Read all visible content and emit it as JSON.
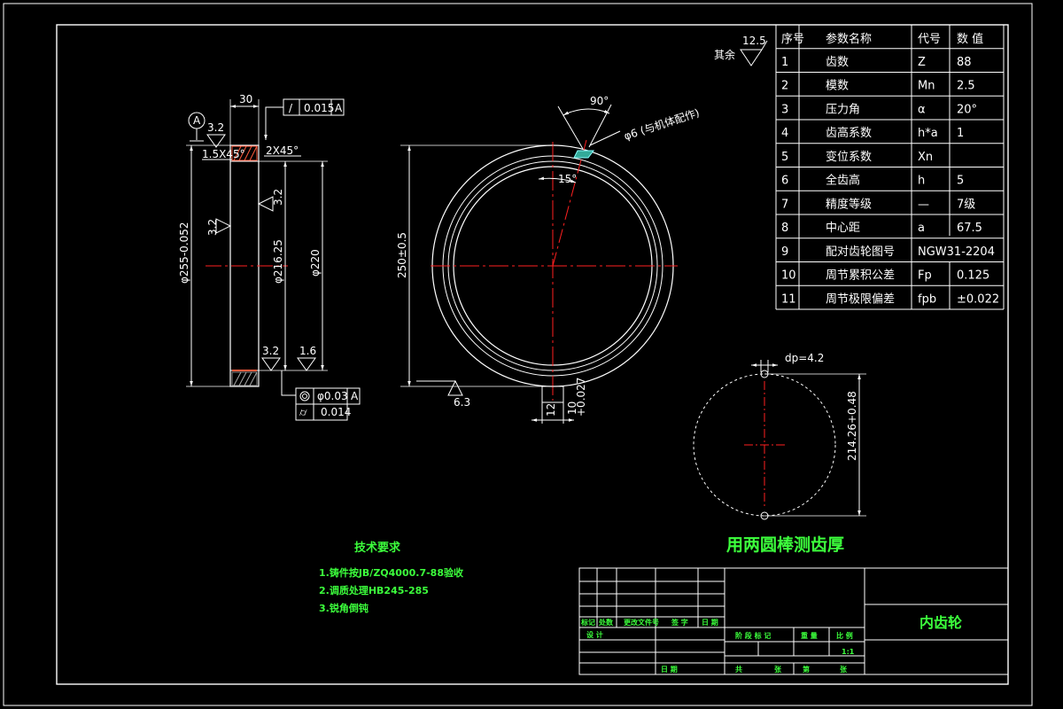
{
  "rough_other": {
    "label": "其余",
    "value": "12.5"
  },
  "param_table": {
    "headers": [
      "序号",
      "参数名称",
      "代号",
      "数 值"
    ],
    "rows": [
      [
        "1",
        "齿数",
        "Z",
        "88"
      ],
      [
        "2",
        "模数",
        "Mn",
        "2.5"
      ],
      [
        "3",
        "压力角",
        "α",
        "20°"
      ],
      [
        "4",
        "齿高系数",
        "h*a",
        "1"
      ],
      [
        "5",
        "变位系数",
        "Xn",
        ""
      ],
      [
        "6",
        "全齿高",
        "h",
        "5"
      ],
      [
        "7",
        "精度等级",
        "—",
        "7级"
      ],
      [
        "8",
        "中心距",
        "a",
        "67.5"
      ],
      [
        "9",
        "配对齿轮图号",
        "NGW31-2204",
        ""
      ],
      [
        "10",
        "周节累积公差",
        "Fp",
        "0.125"
      ],
      [
        "11",
        "周节极限偏差",
        "fpb",
        "±0.022"
      ]
    ]
  },
  "section_view": {
    "dim_width": "30",
    "tol_flatness": {
      "symbol": "/",
      "value": "0.015",
      "datum": "A"
    },
    "datum_label": "A",
    "chamfer_left": "1.5X45°",
    "chamfer_right": "2X45°",
    "rough_top": "3.2",
    "rough_mid": "3.2",
    "rough_left": "3.2",
    "rough_bot1": "3.2",
    "rough_bot2": "1.6",
    "dia_outer": "φ255-0.052",
    "dia_tooth": "φ216.25",
    "dia_inner": "φ220",
    "tol_coax": {
      "value": "φ0.03",
      "datum": "A"
    },
    "tol_runout": {
      "value": "0.014"
    }
  },
  "front_view": {
    "angle_90": "90°",
    "angle_15": "15°",
    "hole_note": "φ6 (与机体配作)",
    "dia": "250±0.5",
    "rough": "6.3",
    "keyway_w": "10",
    "keyway_tol": "+0.027",
    "keyway_depth": "12"
  },
  "measure_view": {
    "dp": "dp=4.2",
    "dim_m": "214.26+0.48",
    "caption": "用两圆棒测齿厚"
  },
  "tech_requirements": {
    "title": "技术要求",
    "items": [
      "1.铸件按JB/ZQ4000.7-88验收",
      "2.调质处理HB245-285",
      "3.锐角倒钝"
    ]
  },
  "title_block": {
    "part_name": "内齿轮",
    "mark": "标记",
    "count": "处数",
    "doc_no": "更改文件号",
    "sign": "签 字",
    "date": "日 期",
    "design": "设 计",
    "stage": "阶 段 标 记",
    "weight": "重 量",
    "scale": "比 例",
    "scale_value": "1:1",
    "sheets_total": "共",
    "sheet": "张",
    "sheet_no": "第",
    "sheet2": "张",
    "approve_date": "日 期"
  }
}
